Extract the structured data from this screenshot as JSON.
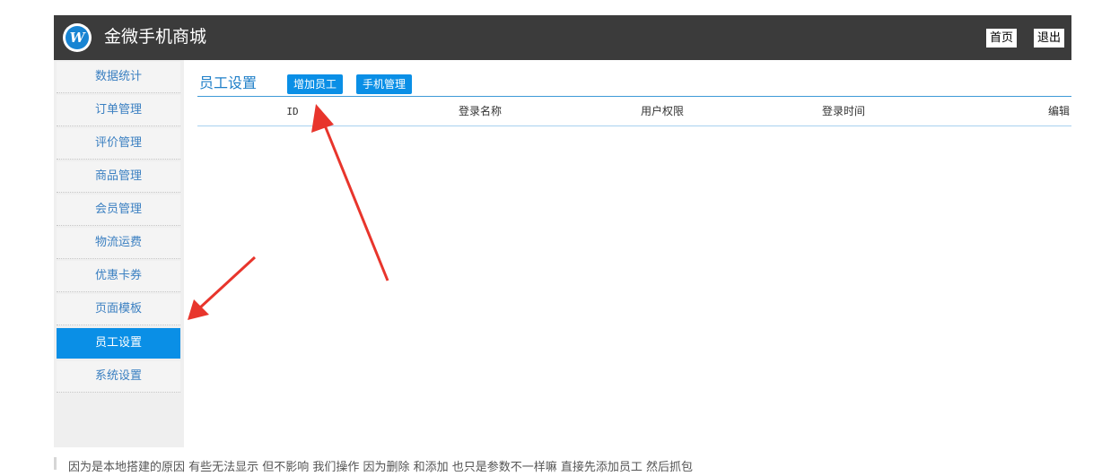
{
  "header": {
    "logo_letter": "W",
    "brand": "金微手机商城",
    "home_label": "首页",
    "exit_label": "退出"
  },
  "sidebar": {
    "items": [
      {
        "label": "数据统计"
      },
      {
        "label": "订单管理"
      },
      {
        "label": "评价管理"
      },
      {
        "label": "商品管理"
      },
      {
        "label": "会员管理"
      },
      {
        "label": "物流运费"
      },
      {
        "label": "优惠卡券"
      },
      {
        "label": "页面模板"
      },
      {
        "label": "员工设置",
        "active": true
      },
      {
        "label": "系统设置"
      }
    ]
  },
  "main": {
    "title": "员工设置",
    "add_button": "增加员工",
    "phone_button": "手机管理",
    "columns": [
      "ID",
      "登录名称",
      "用户权限",
      "登录时间",
      "编辑"
    ]
  },
  "caption": "因为是本地搭建的原因 有些无法显示 但不影响 我们操作 因为删除 和添加 也只是参数不一样嘛 直接先添加员工 然后抓包",
  "colors": {
    "topbar": "#3b3b3b",
    "accent": "#0a8fe6",
    "arrow": "#e8352c"
  }
}
